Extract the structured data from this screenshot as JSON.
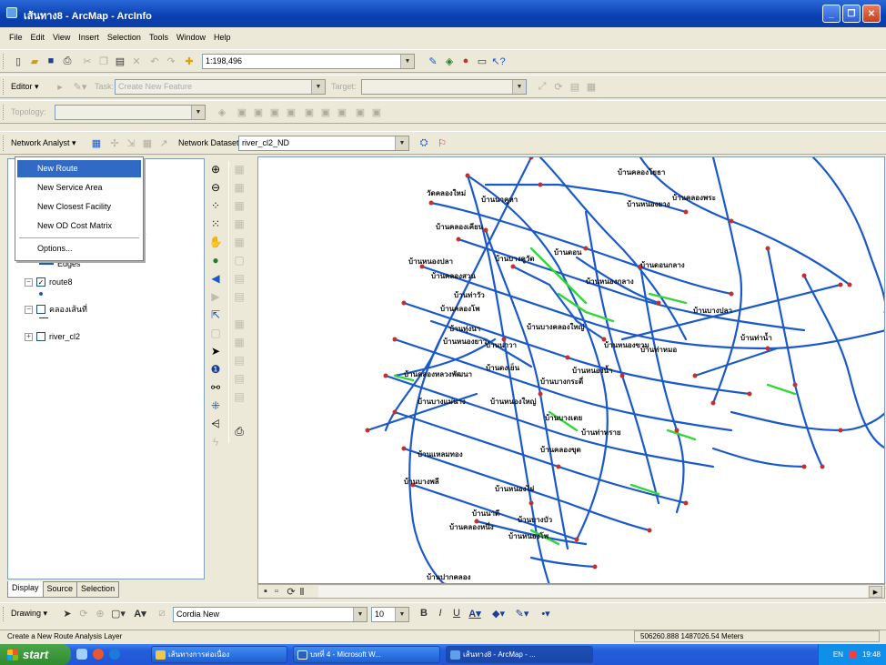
{
  "window": {
    "title": "เส้นทาง8 - ArcMap - ArcInfo"
  },
  "menubar": [
    "File",
    "Edit",
    "View",
    "Insert",
    "Selection",
    "Tools",
    "Window",
    "Help"
  ],
  "standard_toolbar": {
    "scale": "1:198,496"
  },
  "editor_toolbar": {
    "editor_label": "Editor ▾",
    "task_label": "Task:",
    "task_value": "Create New Feature",
    "target_label": "Target:"
  },
  "topology_toolbar": {
    "label": "Topology:"
  },
  "network_toolbar": {
    "network_analyst_label": "Network Analyst ▾",
    "dataset_label": "Network Dataset:",
    "dataset_value": "river_cl2_ND"
  },
  "dropdown": {
    "items": [
      "New Route",
      "New Service Area",
      "New Closest Facility",
      "New OD Cost Matrix",
      "Options..."
    ]
  },
  "toc": {
    "partial_label": "ions",
    "edges_label": "Edges",
    "layers": [
      {
        "name": "route8",
        "checked": true
      },
      {
        "name": "คลองเส้นที่",
        "checked": false
      },
      {
        "name": "river_cl2",
        "checked": false
      }
    ],
    "tabs": [
      "Display",
      "Source",
      "Selection"
    ]
  },
  "map": {
    "labels": [
      "บ้านคลองโยธา",
      "วัดคลองใหม่",
      "บ้านนาคูหา",
      "บ้านหนองยาง",
      "บ้านคลองพระ",
      "บ้านคลองเคียน",
      "บ้านบางคูวัด",
      "บ้านดอน",
      "บ้านดอนกลาง",
      "บ้านหนองปลา",
      "บ้านคลองสวน",
      "บ้านท่าวัว",
      "บ้านหนองกลาง",
      "บ้านบางปลา",
      "บ้านท่าน้ำ",
      "บ้านคลองโพ",
      "บ้านทุ่งนา",
      "บ้านบางคลองใหญ่",
      "บ้านท่าหมอ",
      "บ้านหนองยาว",
      "บ้านนาวา",
      "บ้านหนองขาม",
      "บ้านคลองหลวงพัฒนา",
      "บ้านดงเย็น",
      "บ้านบางกระดี่",
      "บ้านหนองน้ำ",
      "บ้านบางแม่นาง",
      "บ้านหนองใหญ่",
      "บ้านบางเตย",
      "บ้านท่าทราย",
      "บ้านแหลมทอง",
      "บ้านคลองขุด",
      "บ้านบางพลี",
      "บ้านหนองไผ่",
      "บ้านนาดี",
      "บ้านบางบัว",
      "บ้านคลองหนึ่ง",
      "บ้านหนองโพ",
      "บ้านปากคลอง"
    ]
  },
  "drawing_toolbar": {
    "drawing_label": "Drawing ▾",
    "font": "Cordia New",
    "font_size": "10"
  },
  "status": {
    "message": "Create a New Route Analysis Layer",
    "coords": "506260.888  1487026.54 Meters"
  },
  "taskbar": {
    "start": "start",
    "tasks": [
      "เส้นทางการต่อเนื่อง",
      "บทที่ 4 - Microsoft W...",
      "เส้นทาง8 - ArcMap - ..."
    ],
    "tray": [
      "EN",
      "19:48"
    ]
  },
  "colors": {
    "route": "#1a59c9",
    "selected_route": "#35d43a",
    "node": "#c23030",
    "menu_highlight": "#316ac5"
  }
}
